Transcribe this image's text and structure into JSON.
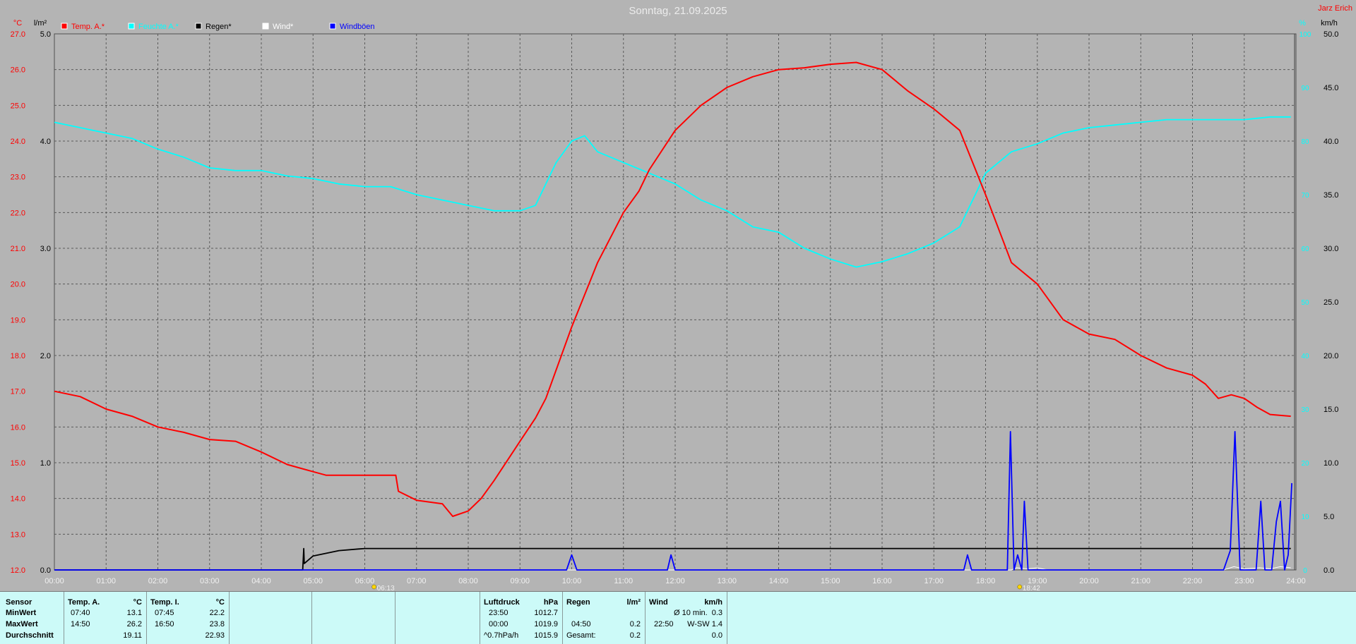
{
  "title": "Sonntag, 21.09.2025",
  "owner": "Jarz Erich",
  "colors": {
    "temp": "#ff0000",
    "hum": "#00ffff",
    "rain": "#000000",
    "wind": "#ffffff",
    "gust": "#0000ff"
  },
  "chart_data": {
    "type": "line",
    "title": "Sonntag, 21.09.2025",
    "x_ticks": [
      "00:00",
      "01:00",
      "02:00",
      "03:00",
      "04:00",
      "05:00",
      "06:00",
      "07:00",
      "08:00",
      "09:00",
      "10:00",
      "11:00",
      "12:00",
      "13:00",
      "14:00",
      "15:00",
      "16:00",
      "17:00",
      "18:00",
      "19:00",
      "20:00",
      "21:00",
      "22:00",
      "23:00",
      "24:00"
    ],
    "axes": {
      "temp": {
        "unit": "°C",
        "min": 12.0,
        "max": 27.0,
        "ticks": [
          "12.0",
          "13.0",
          "14.0",
          "15.0",
          "16.0",
          "17.0",
          "18.0",
          "19.0",
          "20.0",
          "21.0",
          "22.0",
          "23.0",
          "24.0",
          "25.0",
          "26.0",
          "27.0"
        ]
      },
      "rain": {
        "unit": "l/m²",
        "min": 0,
        "max": 5.0,
        "ticks": [
          "0.0",
          "1.0",
          "2.0",
          "3.0",
          "4.0",
          "5.0"
        ]
      },
      "humidity": {
        "unit": "%",
        "min": 0,
        "max": 100,
        "ticks": [
          "0",
          "10",
          "20",
          "30",
          "40",
          "50",
          "60",
          "70",
          "80",
          "90",
          "100"
        ]
      },
      "wind": {
        "unit": "km/h",
        "min": 0,
        "max": 50,
        "ticks": [
          "0.0",
          "5.0",
          "10.0",
          "15.0",
          "20.0",
          "25.0",
          "30.0",
          "35.0",
          "40.0",
          "45.0",
          "50.0"
        ]
      }
    },
    "grid": true,
    "legend": [
      "Temp. A.*",
      "Feuchte A.*",
      "Regen*",
      "Wind*",
      "Windböen"
    ],
    "sun_markers": [
      {
        "time": 6.22,
        "label": "06:13"
      },
      {
        "time": 18.7,
        "label": "18:42"
      }
    ],
    "series": [
      {
        "name": "Temp. A.*",
        "axis": "temp",
        "color": "#ff0000",
        "points": [
          [
            0,
            17.0
          ],
          [
            0.5,
            16.85
          ],
          [
            1,
            16.5
          ],
          [
            1.5,
            16.3
          ],
          [
            2,
            16.0
          ],
          [
            2.5,
            15.85
          ],
          [
            3,
            15.65
          ],
          [
            3.5,
            15.6
          ],
          [
            4,
            15.3
          ],
          [
            4.5,
            14.95
          ],
          [
            4.75,
            14.85
          ],
          [
            5,
            14.75
          ],
          [
            5.25,
            14.65
          ],
          [
            6,
            14.65
          ],
          [
            6.6,
            14.65
          ],
          [
            6.65,
            14.2
          ],
          [
            7,
            13.95
          ],
          [
            7.5,
            13.85
          ],
          [
            7.7,
            13.5
          ],
          [
            8,
            13.65
          ],
          [
            8.25,
            14.0
          ],
          [
            8.5,
            14.5
          ],
          [
            9,
            15.6
          ],
          [
            9.3,
            16.25
          ],
          [
            9.5,
            16.8
          ],
          [
            10,
            18.8
          ],
          [
            10.5,
            20.6
          ],
          [
            11,
            22.0
          ],
          [
            11.3,
            22.6
          ],
          [
            11.5,
            23.2
          ],
          [
            12,
            24.3
          ],
          [
            12.5,
            25.0
          ],
          [
            13,
            25.5
          ],
          [
            13.5,
            25.8
          ],
          [
            14,
            26.0
          ],
          [
            14.5,
            26.05
          ],
          [
            15,
            26.15
          ],
          [
            15.5,
            26.2
          ],
          [
            16,
            26.0
          ],
          [
            16.5,
            25.4
          ],
          [
            17,
            24.9
          ],
          [
            17.5,
            24.3
          ],
          [
            18,
            22.5
          ],
          [
            18.5,
            20.6
          ],
          [
            19,
            20.0
          ],
          [
            19.5,
            19.0
          ],
          [
            20,
            18.6
          ],
          [
            20.5,
            18.45
          ],
          [
            21,
            18.0
          ],
          [
            21.5,
            17.65
          ],
          [
            22,
            17.45
          ],
          [
            22.25,
            17.2
          ],
          [
            22.5,
            16.8
          ],
          [
            22.75,
            16.9
          ],
          [
            23,
            16.8
          ],
          [
            23.25,
            16.55
          ],
          [
            23.5,
            16.35
          ],
          [
            23.9,
            16.3
          ]
        ]
      },
      {
        "name": "Feuchte A.*",
        "axis": "humidity",
        "color": "#00ffff",
        "points": [
          [
            0,
            83.5
          ],
          [
            0.5,
            82.5
          ],
          [
            1,
            81.5
          ],
          [
            1.5,
            80.5
          ],
          [
            2,
            78.5
          ],
          [
            2.5,
            77.0
          ],
          [
            3,
            75.0
          ],
          [
            3.5,
            74.5
          ],
          [
            4,
            74.5
          ],
          [
            4.5,
            73.5
          ],
          [
            5,
            73.0
          ],
          [
            5.5,
            72.0
          ],
          [
            6,
            71.5
          ],
          [
            6.5,
            71.5
          ],
          [
            7,
            70.0
          ],
          [
            7.5,
            69.0
          ],
          [
            8,
            68.0
          ],
          [
            8.5,
            67.0
          ],
          [
            9,
            67.0
          ],
          [
            9.3,
            68.0
          ],
          [
            9.7,
            76.0
          ],
          [
            10,
            80.0
          ],
          [
            10.25,
            81.0
          ],
          [
            10.5,
            78.0
          ],
          [
            11,
            76.0
          ],
          [
            11.5,
            74.0
          ],
          [
            12,
            72.0
          ],
          [
            12.5,
            69.0
          ],
          [
            13,
            67.0
          ],
          [
            13.5,
            64.0
          ],
          [
            14,
            63.0
          ],
          [
            14.5,
            60.0
          ],
          [
            15,
            58.0
          ],
          [
            15.5,
            56.5
          ],
          [
            16,
            57.5
          ],
          [
            16.5,
            59.0
          ],
          [
            17,
            61.0
          ],
          [
            17.5,
            64.0
          ],
          [
            17.9,
            72.0
          ],
          [
            18,
            74.0
          ],
          [
            18.5,
            78.0
          ],
          [
            19,
            79.5
          ],
          [
            19.5,
            81.5
          ],
          [
            20,
            82.5
          ],
          [
            20.5,
            83.0
          ],
          [
            21,
            83.5
          ],
          [
            21.5,
            84.0
          ],
          [
            22,
            84.0
          ],
          [
            22.5,
            84.0
          ],
          [
            23,
            84.0
          ],
          [
            23.5,
            84.5
          ],
          [
            23.9,
            84.5
          ]
        ]
      },
      {
        "name": "Regen*",
        "axis": "rain",
        "color": "#000000",
        "points": [
          [
            0,
            0
          ],
          [
            4.8,
            0
          ],
          [
            4.82,
            0.2
          ],
          [
            4.83,
            0.06
          ],
          [
            5,
            0.13
          ],
          [
            5.5,
            0.18
          ],
          [
            6,
            0.2
          ],
          [
            7,
            0.2
          ],
          [
            12,
            0.2
          ],
          [
            18,
            0.2
          ],
          [
            23.9,
            0.2
          ]
        ]
      },
      {
        "name": "Wind*",
        "axis": "wind",
        "color": "#ffffff",
        "points": [
          [
            0,
            0
          ],
          [
            18.5,
            0
          ],
          [
            18.6,
            0.2
          ],
          [
            18.8,
            0.1
          ],
          [
            19,
            0.2
          ],
          [
            19.2,
            0
          ],
          [
            22.6,
            0
          ],
          [
            22.8,
            0.3
          ],
          [
            23,
            0.1
          ],
          [
            23.3,
            0.2
          ],
          [
            23.5,
            0.1
          ],
          [
            23.7,
            0.3
          ],
          [
            23.9,
            0.2
          ]
        ]
      },
      {
        "name": "Windböen",
        "axis": "wind",
        "color": "#0000ff",
        "points": [
          [
            0,
            0
          ],
          [
            9.9,
            0
          ],
          [
            10,
            1.4
          ],
          [
            10.1,
            0
          ],
          [
            11.85,
            0
          ],
          [
            11.92,
            1.4
          ],
          [
            12.0,
            0
          ],
          [
            17.58,
            0
          ],
          [
            17.65,
            1.4
          ],
          [
            17.73,
            0
          ],
          [
            18.42,
            0
          ],
          [
            18.48,
            12.9
          ],
          [
            18.55,
            0
          ],
          [
            18.62,
            1.4
          ],
          [
            18.7,
            0
          ],
          [
            18.75,
            6.4
          ],
          [
            18.82,
            0
          ],
          [
            22.6,
            0
          ],
          [
            22.73,
            1.8
          ],
          [
            22.82,
            12.9
          ],
          [
            22.92,
            0
          ],
          [
            23.23,
            0
          ],
          [
            23.32,
            6.4
          ],
          [
            23.4,
            0
          ],
          [
            23.53,
            0
          ],
          [
            23.62,
            4.5
          ],
          [
            23.7,
            6.4
          ],
          [
            23.78,
            0
          ],
          [
            23.85,
            1.4
          ],
          [
            23.92,
            8.1
          ]
        ]
      }
    ]
  },
  "stats": {
    "sensor": {
      "header": "Sensor",
      "rows": [
        "MinWert",
        "MaxWert",
        "Durchschnitt"
      ]
    },
    "temp_a": {
      "header": "Temp. A.",
      "unit": "°C",
      "min_time": "07:40",
      "min_val": "13.1",
      "max_time": "14:50",
      "max_val": "26.2",
      "avg": "19.11"
    },
    "temp_i": {
      "header": "Temp. I.",
      "unit": "°C",
      "min_time": "07:45",
      "min_val": "22.2",
      "max_time": "16:50",
      "max_val": "23.8",
      "avg": "22.93"
    },
    "pressure": {
      "header": "Luftdruck",
      "unit": "hPa",
      "r1_label": "23:50",
      "r1_val": "1012.7",
      "r2_label": "00:00",
      "r2_val": "1019.9",
      "r3_label": "^0.7hPa/h",
      "r3_val": "1015.9"
    },
    "rain": {
      "header": "Regen",
      "unit": "l/m²",
      "r2_label": "04:50",
      "r2_val": "0.2",
      "r3_label": "Gesamt:",
      "r3_val": "0.2"
    },
    "wind": {
      "header": "Wind",
      "unit": "km/h",
      "r1_label": "Ø 10 min.",
      "r1_val": "0.3",
      "r2_time": "22:50",
      "r2_val": "W-SW 1.4",
      "r3_val": "0.0"
    }
  }
}
